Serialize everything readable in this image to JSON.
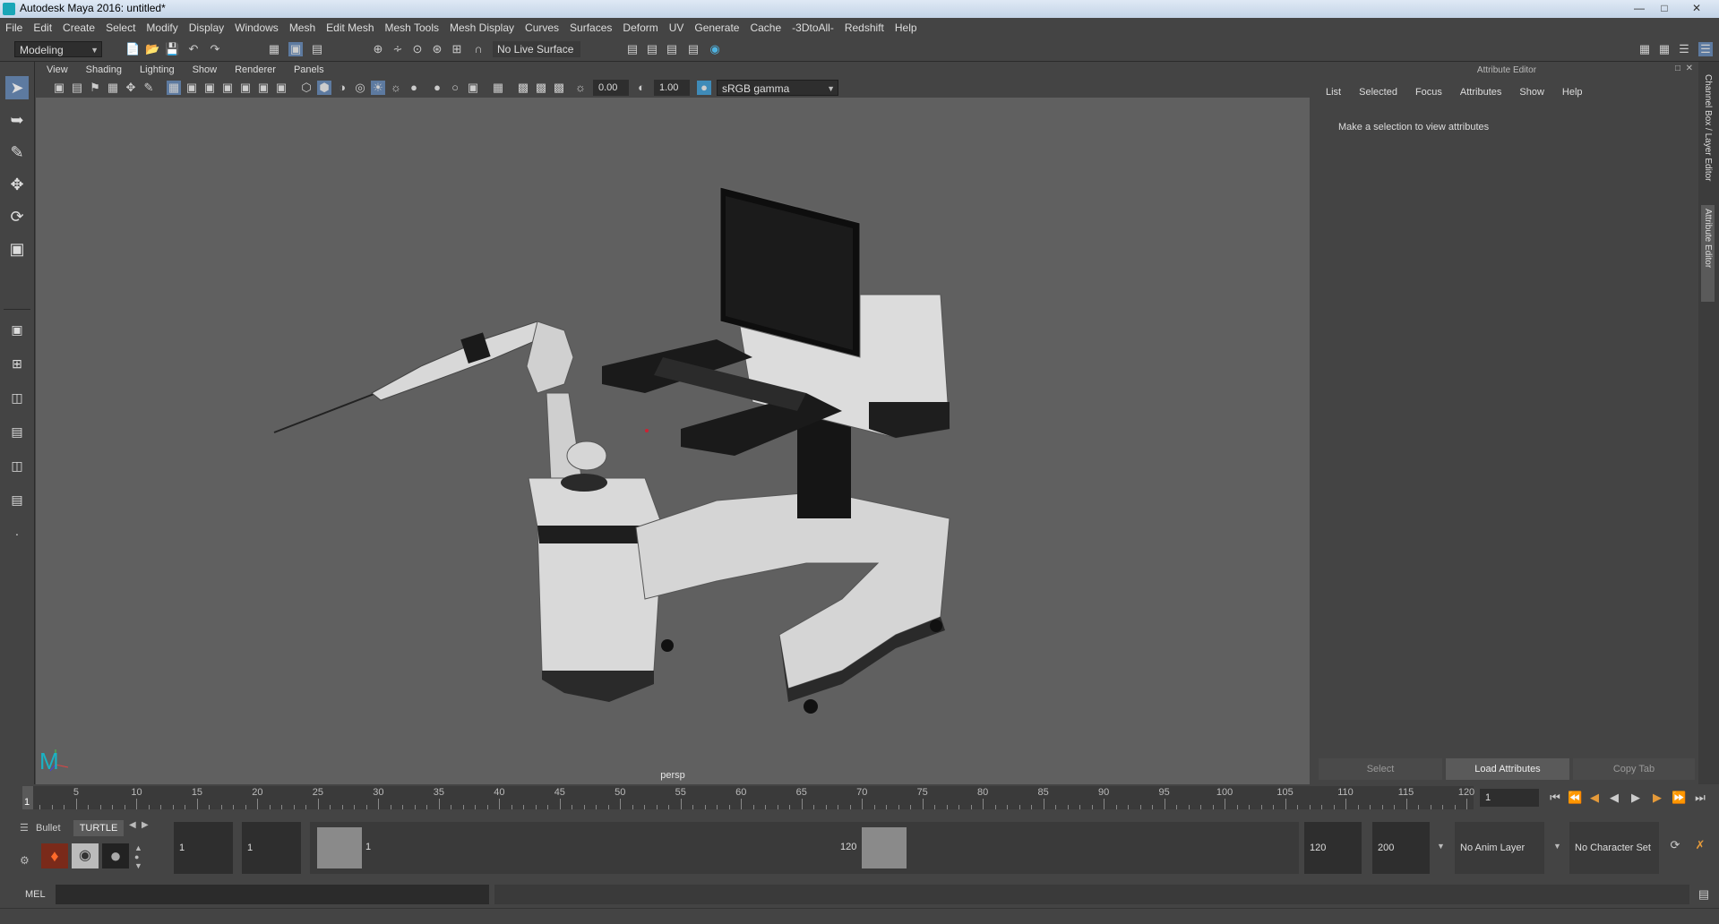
{
  "window": {
    "title": "Autodesk Maya 2016: untitled*"
  },
  "menubar": {
    "items": [
      "File",
      "Edit",
      "Create",
      "Select",
      "Modify",
      "Display",
      "Windows",
      "Mesh",
      "Edit Mesh",
      "Mesh Tools",
      "Mesh Display",
      "Curves",
      "Surfaces",
      "Deform",
      "UV",
      "Generate",
      "Cache",
      "-3DtoAll-",
      "Redshift",
      "Help"
    ]
  },
  "statusline": {
    "mode": "Modeling",
    "live_surface": "No Live Surface"
  },
  "panel": {
    "menus": [
      "View",
      "Shading",
      "Lighting",
      "Show",
      "Renderer",
      "Panels"
    ],
    "exposure": "0.00",
    "gamma": "1.00",
    "colorspace": "sRGB gamma",
    "camera": "persp"
  },
  "attribute_editor": {
    "title": "Attribute Editor",
    "menus": [
      "List",
      "Selected",
      "Focus",
      "Attributes",
      "Show",
      "Help"
    ],
    "message": "Make a selection to view attributes",
    "buttons": {
      "select": "Select",
      "load": "Load Attributes",
      "copy": "Copy Tab"
    },
    "side_tabs": {
      "channel": "Channel Box / Layer Editor",
      "attr": "Attribute Editor"
    }
  },
  "timeslider": {
    "ticks": [
      "5",
      "10",
      "15",
      "20",
      "25",
      "30",
      "35",
      "40",
      "45",
      "50",
      "55",
      "60",
      "65",
      "70",
      "75",
      "80",
      "85",
      "90",
      "95",
      "100",
      "105",
      "110",
      "115",
      "120"
    ],
    "first_label": "1",
    "current_frame": "1"
  },
  "range": {
    "shelf_tabs": [
      "Bullet",
      "TURTLE"
    ],
    "start_frame": "1",
    "playback_start": "1",
    "range_start_label": "1",
    "range_end_label": "120",
    "playback_end": "120",
    "end_frame": "200",
    "anim_layer": "No Anim Layer",
    "character_set": "No Character Set"
  },
  "cmdline": {
    "label": "MEL"
  }
}
